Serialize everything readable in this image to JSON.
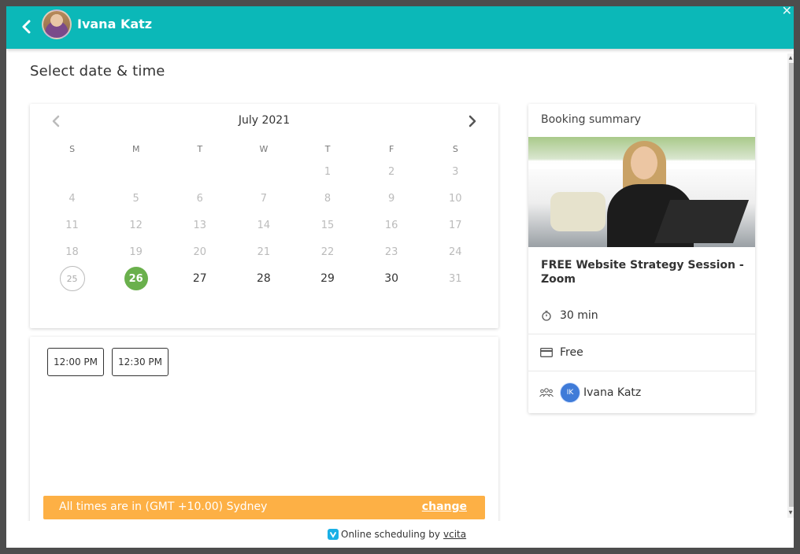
{
  "header": {
    "name": "Ivana Katz"
  },
  "page": {
    "title": "Select date & time"
  },
  "calendar": {
    "month": "July 2021",
    "weekdays": [
      "S",
      "M",
      "T",
      "W",
      "T",
      "F",
      "S"
    ],
    "weeks": [
      [
        "",
        "",
        "",
        "",
        "1",
        "2",
        "3"
      ],
      [
        "4",
        "5",
        "6",
        "7",
        "8",
        "9",
        "10"
      ],
      [
        "11",
        "12",
        "13",
        "14",
        "15",
        "16",
        "17"
      ],
      [
        "18",
        "19",
        "20",
        "21",
        "22",
        "23",
        "24"
      ],
      [
        "25",
        "26",
        "27",
        "28",
        "29",
        "30",
        "31"
      ]
    ],
    "today": "25",
    "selected": "26",
    "available": [
      "26",
      "27",
      "28",
      "29",
      "30"
    ]
  },
  "slots": [
    "12:00 PM",
    "12:30 PM"
  ],
  "timezone": {
    "text": "All times are in (GMT +10.00) Sydney",
    "change_label": "change"
  },
  "summary": {
    "header": "Booking summary",
    "service_title": "FREE Website Strategy Session - Zoom",
    "duration": "30 min",
    "price": "Free",
    "staff_initials": "IK",
    "staff_name": "Ivana Katz"
  },
  "footer": {
    "text": "Online scheduling by",
    "link": "vcita"
  },
  "colors": {
    "header": "#0bb8b8",
    "selected_day": "#6ab04c",
    "timezone_bar": "#fdb045",
    "staff_badge": "#3f7bd8"
  }
}
